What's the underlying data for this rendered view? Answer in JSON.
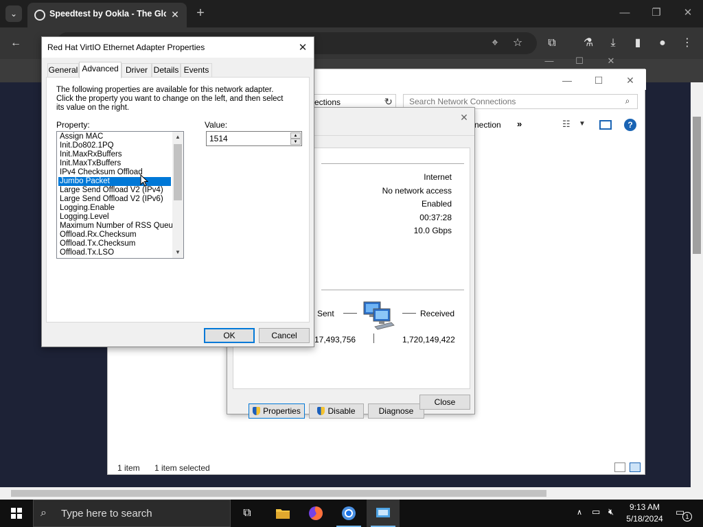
{
  "browser": {
    "tab_title": "Speedtest by Ookla - The Glob",
    "tab_close": "✕",
    "new_tab": "+"
  },
  "network_window": {
    "address_fragment": "ections",
    "search_placeholder": "Search Network Connections",
    "command_partial": "nection",
    "more": "»",
    "status_count": "1 item",
    "status_selected": "1 item selected"
  },
  "status_dialog": {
    "values": [
      "Internet",
      "No network access",
      "Enabled",
      "00:37:28",
      "10.0 Gbps"
    ],
    "sent_label": "Sent",
    "received_label": "Received",
    "sent_value": "17,493,756",
    "received_value": "1,720,149,422",
    "properties_button": "Properties",
    "disable_button": "Disable",
    "diagnose_button": "Diagnose",
    "close_button": "Close"
  },
  "adapter_dialog": {
    "title": "Red Hat VirtIO Ethernet Adapter Properties",
    "tabs": [
      "General",
      "Advanced",
      "Driver",
      "Details",
      "Events"
    ],
    "active_tab": "Advanced",
    "description": "The following properties are available for this network adapter. Click the property you want to change on the left, and then select its value on the right.",
    "property_label": "Property:",
    "value_label": "Value:",
    "properties": [
      "Assign MAC",
      "Init.Do802.1PQ",
      "Init.MaxRxBuffers",
      "Init.MaxTxBuffers",
      "IPv4 Checksum Offload",
      "Jumbo Packet",
      "Large Send Offload V2 (IPv4)",
      "Large Send Offload V2 (IPv6)",
      "Logging.Enable",
      "Logging.Level",
      "Maximum Number of RSS Queues",
      "Offload.Rx.Checksum",
      "Offload.Tx.Checksum",
      "Offload.Tx.LSO"
    ],
    "selected_property": "Jumbo Packet",
    "value": "1514",
    "ok_button": "OK",
    "cancel_button": "Cancel"
  },
  "taskbar": {
    "search_placeholder": "Type here to search",
    "time": "9:13 AM",
    "date": "5/18/2024",
    "notification_count": "1"
  },
  "colors": {
    "selection": "#0078d7",
    "taskbar": "#101010",
    "page_background": "#1d2236"
  }
}
